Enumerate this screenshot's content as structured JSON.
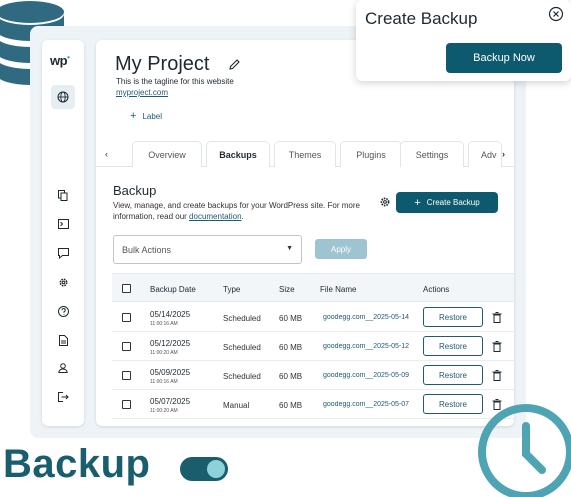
{
  "colors": {
    "accent": "#0d5a6e",
    "brand": "#1a5e6e",
    "link": "#1e5b70",
    "apply_disabled": "#9ec4d1"
  },
  "sidebar": {
    "logo": "wp",
    "icons": [
      "globe-icon",
      "copy-icon",
      "terminal-icon",
      "chat-icon",
      "gear-icon",
      "help-icon",
      "document-icon",
      "user-icon",
      "logout-icon"
    ]
  },
  "project": {
    "title": "My Project",
    "tagline": "This is the tagline for this website",
    "domain": "myproject.com",
    "label_button": "Label"
  },
  "tabs": [
    {
      "label": "Overview"
    },
    {
      "label": "Backups"
    },
    {
      "label": "Themes"
    },
    {
      "label": "Plugins"
    },
    {
      "label": "Settings"
    },
    {
      "label": "Adv"
    }
  ],
  "active_tab": "Backups",
  "backup": {
    "title": "Backup",
    "description": "View, manage, and create backups for your WordPress site. For more information, read our ",
    "doc_link": "documentation",
    "after_link": ".",
    "create_label": "Create Backup",
    "bulk_placeholder": "Bulk Actions",
    "apply_label": "Apply"
  },
  "table": {
    "headers": [
      "Backup Date",
      "Type",
      "Size",
      "File Name",
      "Actions"
    ],
    "rows": [
      {
        "date": "05/14/2025",
        "time": "11:00:16 AM",
        "type": "Scheduled",
        "size": "60 MB",
        "file": "goodegg.com__2025-05-14",
        "action": "Restore"
      },
      {
        "date": "05/12/2025",
        "time": "11:00:20 AM",
        "type": "Scheduled",
        "size": "60 MB",
        "file": "goodegg.com__2025-05-12",
        "action": "Restore"
      },
      {
        "date": "05/09/2025",
        "time": "11:00:16 AM",
        "type": "Scheduled",
        "size": "60 MB",
        "file": "goodegg.com__2025-05-09",
        "action": "Restore"
      },
      {
        "date": "05/07/2025",
        "time": "11:00:20 AM",
        "type": "Manual",
        "size": "60 MB",
        "file": "goodegg.com__2025-05-07",
        "action": "Restore"
      }
    ]
  },
  "popup": {
    "title": "Create Backup",
    "button": "Backup Now"
  },
  "big_label": "Backup",
  "toggle_on": true
}
